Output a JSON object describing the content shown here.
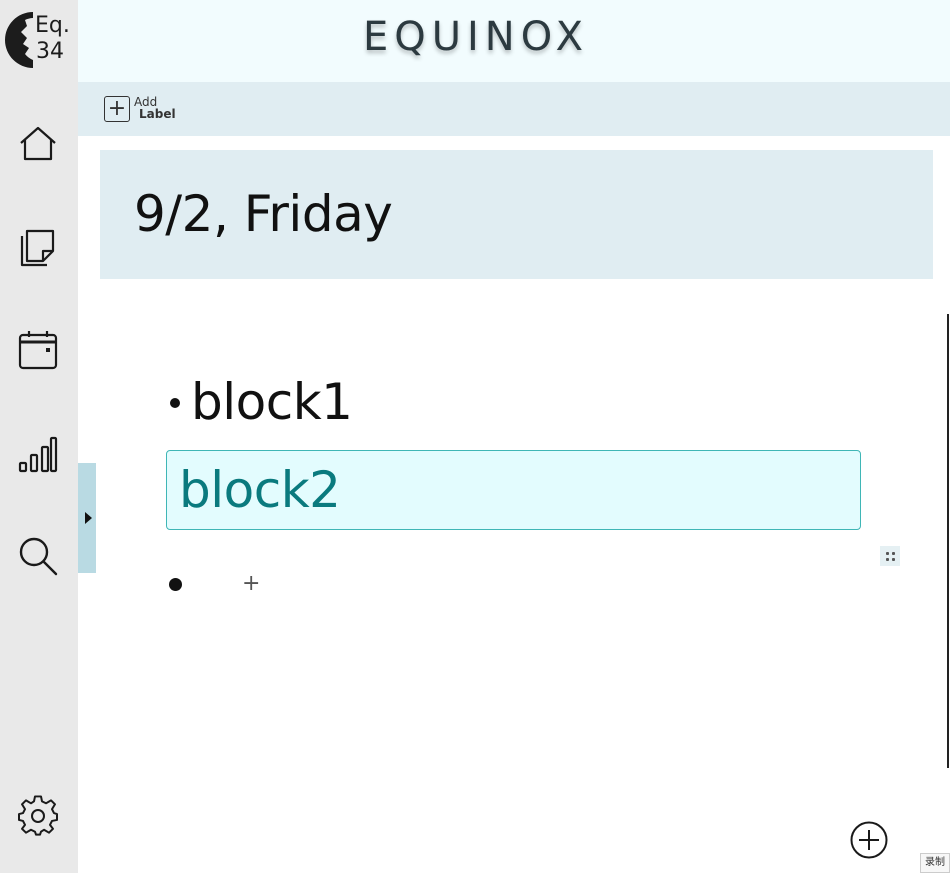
{
  "app": {
    "title": "EQUINOX"
  },
  "logo": {
    "line1": "Eq.",
    "line2": "34"
  },
  "sidebar": {
    "items": [
      {
        "name": "home",
        "icon": "home-icon"
      },
      {
        "name": "notes",
        "icon": "notes-icon"
      },
      {
        "name": "calendar",
        "icon": "calendar-icon"
      },
      {
        "name": "stats",
        "icon": "bar-chart-icon"
      },
      {
        "name": "search",
        "icon": "search-icon"
      },
      {
        "name": "settings",
        "icon": "gear-icon"
      }
    ]
  },
  "toolbar": {
    "add_label_line1": "Add",
    "add_label_line2": "Label"
  },
  "page": {
    "date_title": "9/2, Friday"
  },
  "blocks": [
    {
      "text": "block1",
      "focused": false
    },
    {
      "text": "block2",
      "focused": true
    },
    {
      "text": "",
      "focused": false
    }
  ],
  "controls": {
    "add_block_symbol": "+"
  },
  "footer": {
    "record_tag": "录制"
  },
  "colors": {
    "sidebar": "#e9e9e9",
    "header": "#f2fcfe",
    "banner": "#e0edf2",
    "focus_bg": "#e3fcfe",
    "focus_border": "#3fb6b6",
    "focus_text": "#0a7a7e",
    "handle": "#b9dae3"
  }
}
